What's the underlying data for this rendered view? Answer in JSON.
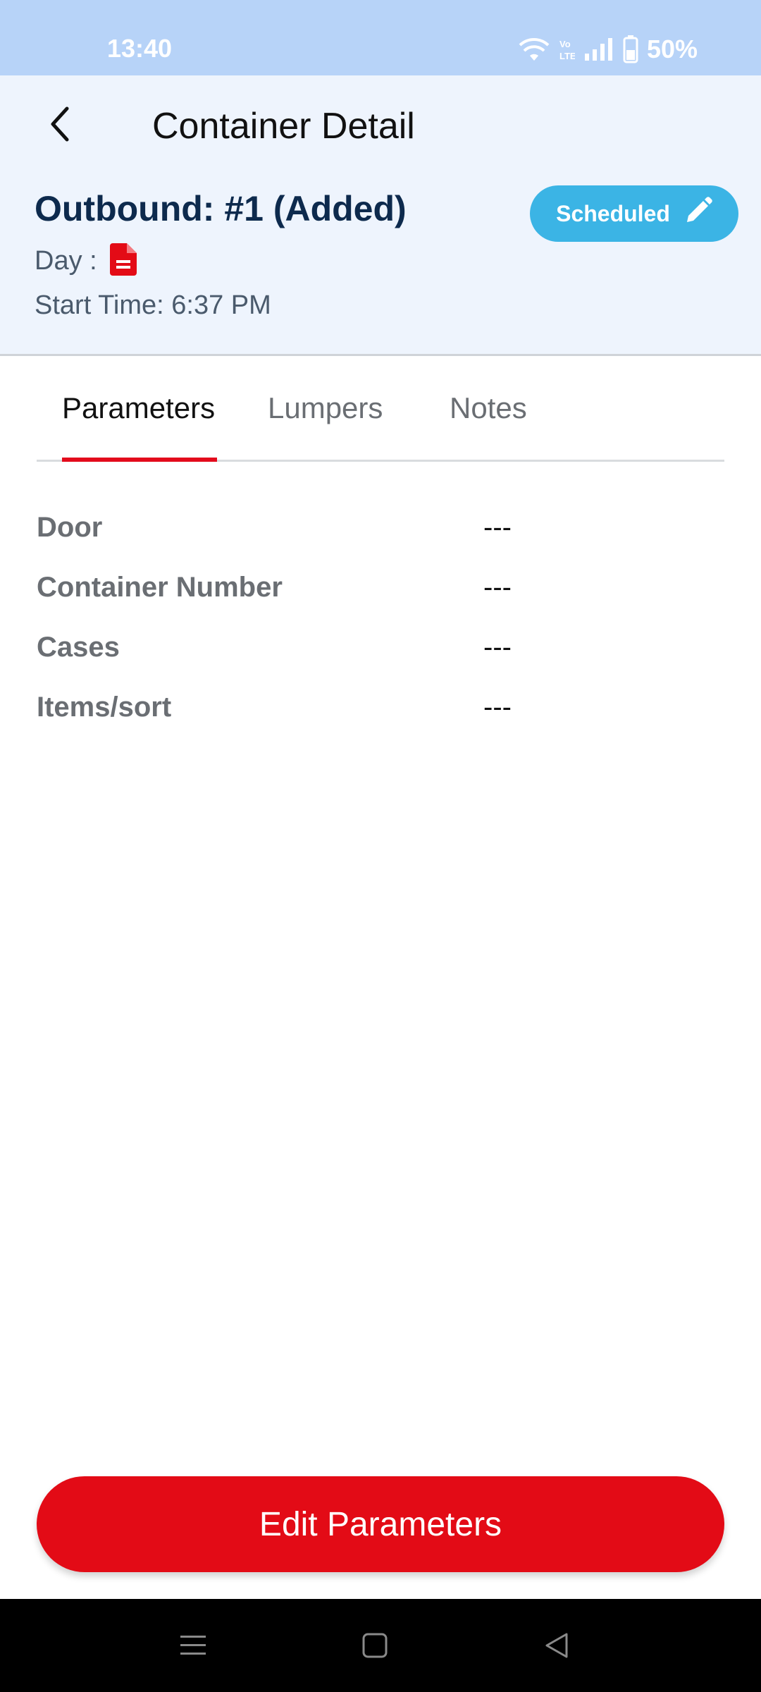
{
  "status_bar": {
    "time": "13:40",
    "battery": "50%",
    "icons": [
      "wifi-icon",
      "volte-icon",
      "signal-icon",
      "battery-icon"
    ]
  },
  "header": {
    "back_icon": "back-arrow-icon",
    "title": "Container Detail",
    "outbound_title": "Outbound: #1 (Added)",
    "day_label": "Day :",
    "day_icon": "document-icon",
    "start_time": "Start Time: 6:37 PM",
    "status_chip": {
      "label": "Scheduled",
      "icon": "pencil-icon"
    }
  },
  "tabs": [
    {
      "label": "Parameters",
      "active": true
    },
    {
      "label": "Lumpers",
      "active": false
    },
    {
      "label": "Notes",
      "active": false
    }
  ],
  "parameters": [
    {
      "label": "Door",
      "value": "---"
    },
    {
      "label": "Container Number",
      "value": "---"
    },
    {
      "label": "Cases",
      "value": "---"
    },
    {
      "label": "Items/sort",
      "value": "---"
    }
  ],
  "edit_button": {
    "label": "Edit Parameters"
  },
  "nav_bar": {
    "buttons": [
      "menu-icon",
      "home-icon",
      "back-icon"
    ]
  },
  "colors": {
    "accent_red": "#e30b16",
    "chip_blue": "#3bb4e5",
    "header_bg": "#eef4fd",
    "status_bar_bg": "#b7d3f8",
    "title_navy": "#0d2a4d"
  }
}
